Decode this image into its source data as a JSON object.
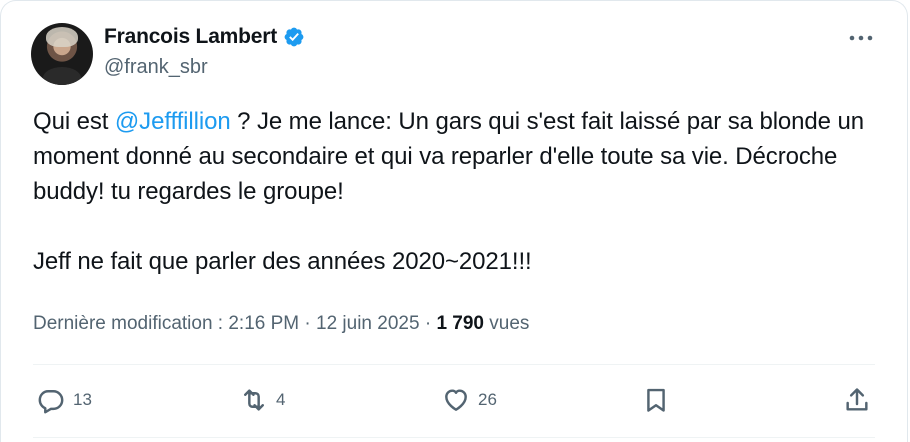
{
  "author": {
    "name": "Francois Lambert",
    "handle": "@frank_sbr",
    "verified": true,
    "verified_color": "#1d9bf0"
  },
  "tweet": {
    "text_before_mention": "Qui est ",
    "mention": "@Jefffillion",
    "text_after_mention": " ? Je me lance: Un gars qui s'est fait laissé par sa blonde un moment donné au secondaire et qui va reparler d'elle toute sa vie. Décroche buddy! tu regardes le groupe!",
    "second_paragraph": "Jeff ne fait que parler des années 2020~2021!!!",
    "mention_color": "#1d9bf0"
  },
  "meta": {
    "edited_label": "Dernière modification : 2:16 PM · 12 juin 2025 · ",
    "views_count": "1 790",
    "views_label": " vues"
  },
  "actions": {
    "replies": "13",
    "reposts": "4",
    "likes": "26"
  },
  "icons": [
    "verified-badge-icon",
    "more-icon",
    "reply-icon",
    "repost-icon",
    "like-icon",
    "bookmark-icon",
    "share-icon"
  ]
}
